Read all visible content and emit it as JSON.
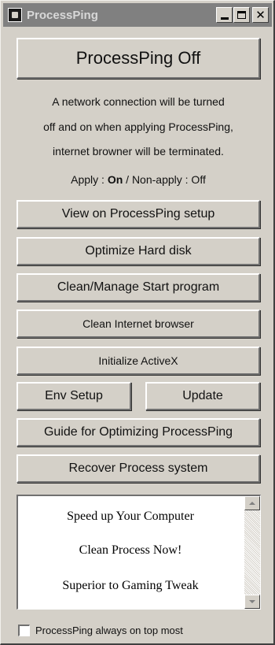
{
  "window": {
    "title": "ProcessPing"
  },
  "main_button": {
    "label": "ProcessPing Off"
  },
  "info": {
    "line1": "A network connection will be turned",
    "line2": "off and on when applying ProcessPing,",
    "line3": "internet browner will be terminated.",
    "apply_label": "Apply : ",
    "apply_on": "On",
    "apply_rest": " / Non-apply : Off"
  },
  "buttons": {
    "view_setup": "View on ProcessPing setup",
    "optimize_disk": "Optimize Hard disk",
    "clean_start": "Clean/Manage Start program",
    "clean_browser": "Clean Internet browser",
    "init_activex": "Initialize ActiveX",
    "env_setup": "Env Setup",
    "update": "Update",
    "guide": "Guide for Optimizing ProcessPing",
    "recover": "Recover Process system"
  },
  "ad_list": {
    "items": [
      "Speed up Your Computer",
      "Clean Process Now!",
      "Superior to Gaming Tweak"
    ]
  },
  "always_on_top": {
    "label": "ProcessPing always on top most",
    "checked": false
  },
  "icons": {
    "app": "processping-app-icon",
    "minimize": "minimize-icon",
    "maximize": "maximize-icon",
    "close": "close-icon",
    "scroll_up": "scroll-up-arrow-icon",
    "scroll_down": "scroll-down-arrow-icon"
  },
  "colors": {
    "face": "#d4d0c8",
    "titlebar_inactive": "#808080"
  }
}
